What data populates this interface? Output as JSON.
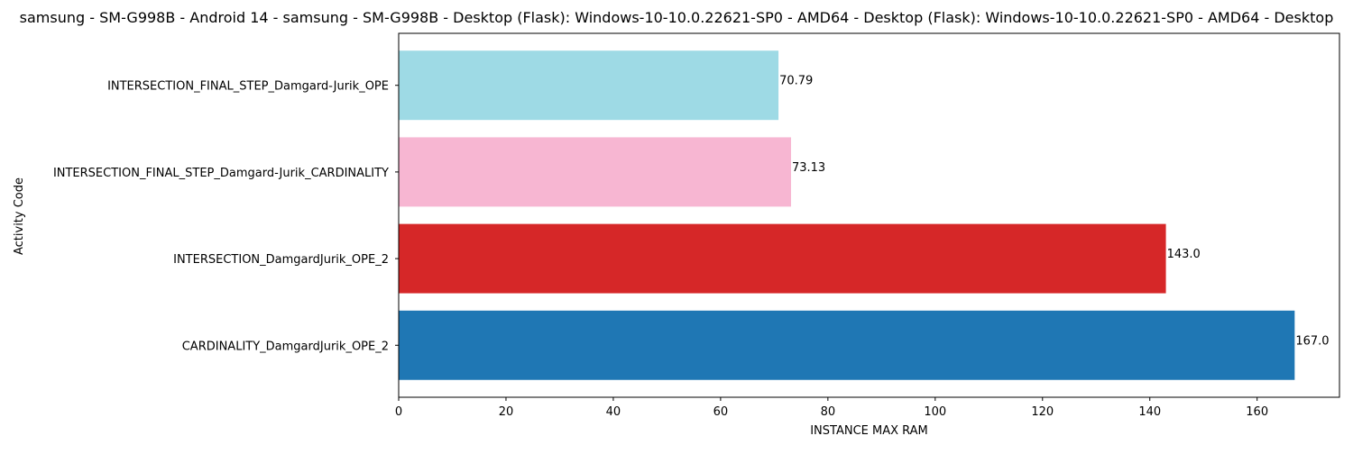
{
  "chart_data": {
    "type": "bar",
    "orientation": "horizontal",
    "title": "samsung - SM-G998B - Android 14 - samsung - SM-G998B - Desktop (Flask): Windows-10-10.0.22621-SP0 - AMD64 - Desktop (Flask): Windows-10-10.0.22621-SP0 - AMD64 - Desktop",
    "xlabel": "INSTANCE MAX RAM",
    "ylabel": "Activity Code",
    "categories": [
      "CARDINALITY_DamgardJurik_OPE_2",
      "INTERSECTION_DamgardJurik_OPE_2",
      "INTERSECTION_FINAL_STEP_Damgard-Jurik_CARDINALITY",
      "INTERSECTION_FINAL_STEP_Damgard-Jurik_OPE"
    ],
    "values": [
      167.0,
      143.0,
      73.13,
      70.79
    ],
    "value_labels": [
      "167.0",
      "143.0",
      "73.13",
      "70.79"
    ],
    "colors": [
      "#1f77b4",
      "#d62728",
      "#f7b6d2",
      "#9edae5"
    ],
    "xlim": [
      0,
      175.35
    ],
    "xticks": [
      0,
      20,
      40,
      60,
      80,
      100,
      120,
      140,
      160
    ],
    "grid": false,
    "legend": "none"
  }
}
